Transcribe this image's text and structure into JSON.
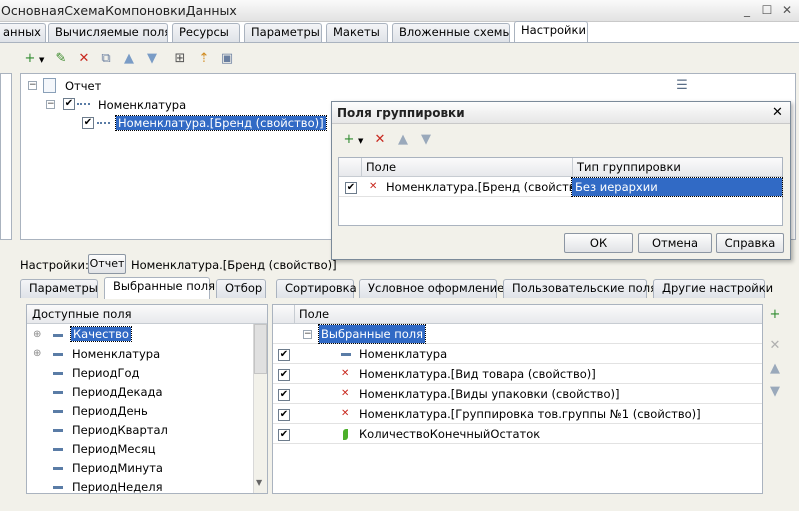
{
  "window": {
    "title": "ОсновнаяСхемаКомпоновкиДанных",
    "minimize": "_",
    "maximize": "☐",
    "close": "✕"
  },
  "tabs": [
    {
      "label": "анных"
    },
    {
      "label": "Вычисляемые поля"
    },
    {
      "label": "Ресурсы"
    },
    {
      "label": "Параметры"
    },
    {
      "label": "Макеты"
    },
    {
      "label": "Вложенные схемы"
    },
    {
      "label": "Настройки"
    }
  ],
  "tree": {
    "root": "Отчет",
    "child": "Номенклатура",
    "leaf": "Номенклатура.[Бренд (свойство)]"
  },
  "dialog": {
    "title": "Поля группировки",
    "close": "✕",
    "col_field": "Поле",
    "col_type": "Тип группировки",
    "row_field": "Номенклатура.[Бренд (свойство)]",
    "row_type": "Без иерархии",
    "ok": "ОК",
    "cancel": "Отмена",
    "help": "Справка"
  },
  "settings_line": {
    "label": "Настройки:",
    "button": "Отчет",
    "value": "Номенклатура.[Бренд (свойство)]"
  },
  "bottom_tabs": [
    {
      "label": "Параметры"
    },
    {
      "label": "Выбранные поля"
    },
    {
      "label": "Отбор"
    },
    {
      "label": "Сортировка"
    },
    {
      "label": "Условное оформление"
    },
    {
      "label": "Пользовательские поля"
    },
    {
      "label": "Другие настройки"
    }
  ],
  "available": {
    "header": "Доступные поля",
    "items": [
      "Качество",
      "Номенклатура",
      "ПериодГод",
      "ПериодДекада",
      "ПериодДень",
      "ПериодКвартал",
      "ПериодМесяц",
      "ПериодМинута",
      "ПериодНеделя"
    ]
  },
  "selected": {
    "header": "Поле",
    "group": "Выбранные поля",
    "items": [
      "Номенклатура",
      "Номенклатура.[Вид товара (свойство)]",
      "Номенклатура.[Виды упаковки (свойство)]",
      "Номенклатура.[Группировка тов.группы №1 (свойство)]",
      "КоличествоКонечныйОстаток"
    ]
  },
  "colors": {
    "selection": "#316ac5",
    "background": "#f2f1ea",
    "border": "#aab3bf"
  }
}
